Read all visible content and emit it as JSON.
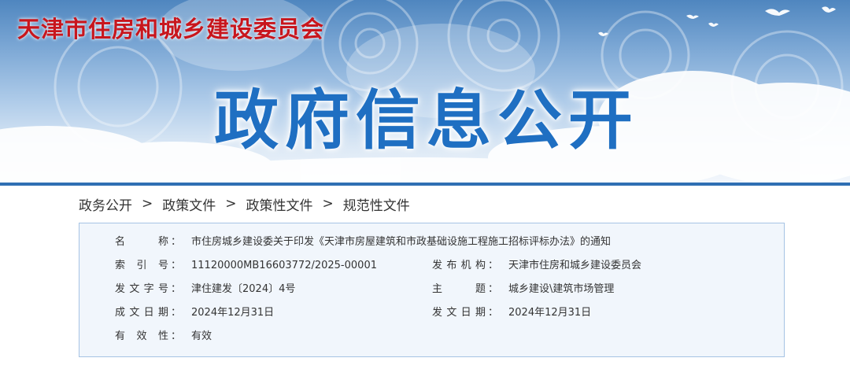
{
  "header": {
    "site_name": "天津市住房和城乡建设委员会",
    "banner_title": "政府信息公开"
  },
  "breadcrumb": [
    "政务公开",
    "政策文件",
    "政策性文件",
    "规范性文件"
  ],
  "breadcrumb_separator": ">",
  "info": {
    "name": {
      "label": "名　　称",
      "value": "市住房城乡建设委关于印发《天津市房屋建筑和市政基础设施工程施工招标评标办法》的通知"
    },
    "index_no": {
      "label": "索引号",
      "value": "11120000MB16603772/2025-00001"
    },
    "publisher": {
      "label": "发布机构",
      "value": "天津市住房和城乡建设委员会"
    },
    "doc_no": {
      "label": "发文字号",
      "value": "津住建发〔2024〕4号"
    },
    "subject": {
      "label": "主　　题",
      "value": "城乡建设\\建筑市场管理"
    },
    "created": {
      "label": "成文日期",
      "value": "2024年12月31日"
    },
    "issued": {
      "label": "发文日期",
      "value": "2024年12月31日"
    },
    "validity": {
      "label": "有效性",
      "value": "有效"
    },
    "colon": "："
  },
  "colors": {
    "site_name": "#c8161d",
    "banner_title": "#1f6fc2",
    "rule": "#2f6fb3",
    "panel_bg": "#f1f6fc",
    "panel_border": "#a6c3e4"
  }
}
